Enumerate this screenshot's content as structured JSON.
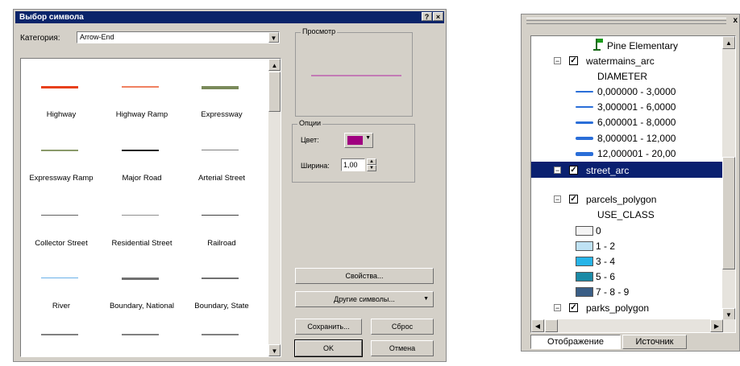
{
  "dialog": {
    "title": "Выбор символа",
    "help_button": "?",
    "close_button": "×",
    "category_label": "Категория:",
    "category_value": "Arrow-End",
    "preview_label": "Просмотр",
    "options_label": "Опции",
    "color_label": "Цвет:",
    "color_value": "#a00080",
    "width_label": "Ширина:",
    "width_value": "1,00",
    "buttons": {
      "properties": "Свойства...",
      "more_symbols": "Другие символы...",
      "save": "Сохранить...",
      "reset": "Сброс",
      "ok": "OK",
      "cancel": "Отмена"
    },
    "symbols": [
      {
        "label": "Highway",
        "color": "#e8401c",
        "thickness": 3
      },
      {
        "label": "Highway Ramp",
        "color": "#f08060",
        "thickness": 2
      },
      {
        "label": "Expressway",
        "color": "#7a8a5a",
        "thickness": 4
      },
      {
        "label": "Expressway Ramp",
        "color": "#8a9a6a",
        "thickness": 2
      },
      {
        "label": "Major Road",
        "color": "#202020",
        "thickness": 2
      },
      {
        "label": "Arterial Street",
        "color": "#808080",
        "thickness": 1
      },
      {
        "label": "Collector Street",
        "color": "#606060",
        "thickness": 1
      },
      {
        "label": "Residential Street",
        "color": "#909090",
        "thickness": 1
      },
      {
        "label": "Railroad",
        "color": "#404040",
        "thickness": 1
      },
      {
        "label": "River",
        "color": "#6ab0e8",
        "thickness": 1
      },
      {
        "label": "Boundary, National",
        "color": "#707070",
        "thickness": 3
      },
      {
        "label": "Boundary, State",
        "color": "#707070",
        "thickness": 2
      }
    ]
  },
  "toc": {
    "close": "x",
    "items": [
      {
        "text": "Pine Elementary",
        "kind": "label"
      },
      {
        "text": "watermains_arc",
        "kind": "layer"
      },
      {
        "text": "DIAMETER",
        "kind": "field"
      },
      {
        "text": "0,000000 - 3,0000",
        "kind": "legend-line",
        "w": 2
      },
      {
        "text": "3,000001 - 6,0000",
        "kind": "legend-line",
        "w": 2
      },
      {
        "text": "6,000001 - 8,0000",
        "kind": "legend-line",
        "w": 3
      },
      {
        "text": "8,000001 - 12,000",
        "kind": "legend-line",
        "w": 4
      },
      {
        "text": "12,000001 - 20,00",
        "kind": "legend-line",
        "w": 5
      },
      {
        "text": "street_arc",
        "kind": "layer-selected"
      },
      {
        "text": "parcels_polygon",
        "kind": "layer"
      },
      {
        "text": "USE_CLASS",
        "kind": "field"
      },
      {
        "text": "0",
        "kind": "legend-box",
        "fill": "#f4f4f4"
      },
      {
        "text": "1 - 2",
        "kind": "legend-box",
        "fill": "#bfe2f4"
      },
      {
        "text": "3 - 4",
        "kind": "legend-box",
        "fill": "#27b4e8"
      },
      {
        "text": "5 - 6",
        "kind": "legend-box",
        "fill": "#1b8aa6"
      },
      {
        "text": "7 - 8 - 9",
        "kind": "legend-box",
        "fill": "#3a5e86"
      },
      {
        "text": "parks_polygon",
        "kind": "layer"
      }
    ],
    "tabs": [
      "Отображение",
      "Источник"
    ]
  }
}
